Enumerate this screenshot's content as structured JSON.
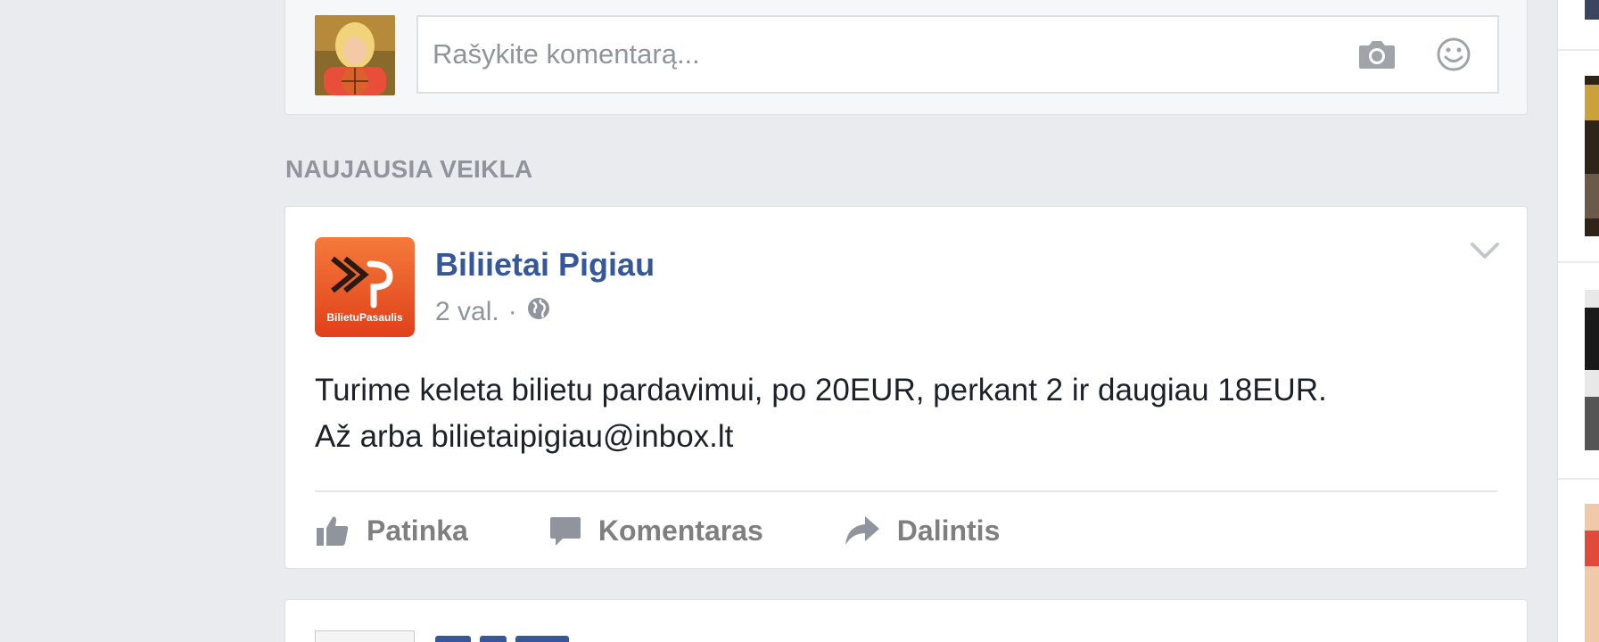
{
  "composer": {
    "placeholder": "Rašykite komentarą...",
    "avatar_icon": "user-avatar",
    "camera_icon": "camera-icon",
    "emoji_icon": "emoji-icon"
  },
  "feed": {
    "section_heading": "NAUJAUSIA VEIKLA"
  },
  "post": {
    "author": "Biliietai Pigiau",
    "time": "2 val.",
    "separator": "·",
    "privacy_icon": "globe-icon",
    "text_line1": "Turime keleta bilietu pardavimui, po 20EUR, perkant 2 ir daugiau 18EUR.",
    "text_line2": "Až arba bilietaipigiau@inbox.lt",
    "avatar_icon": "bilietu-pasaulis-logo",
    "avatar_caption": "BilietuPasaulis",
    "menu_icon": "chevron-down-icon",
    "actions": {
      "like": "Patinka",
      "comment": "Komentaras",
      "share": "Dalintis"
    }
  },
  "colors": {
    "page_bg": "#e9ebee",
    "link_blue": "#365899",
    "muted": "#90949c",
    "logo_orange": "#f05a22"
  }
}
